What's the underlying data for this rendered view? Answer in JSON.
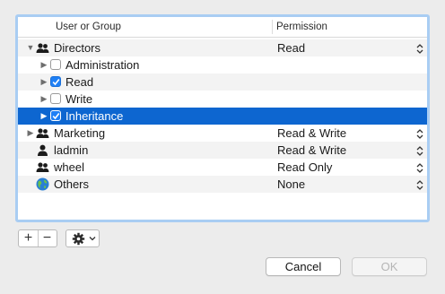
{
  "table": {
    "columns": {
      "user_or_group": "User or Group",
      "permission": "Permission"
    },
    "rows": [
      {
        "name": "Directors",
        "permission": "Read",
        "kind": "group",
        "expanded": true
      },
      {
        "name": "Administration",
        "checked": false,
        "kind": "privilege"
      },
      {
        "name": "Read",
        "checked": true,
        "kind": "privilege"
      },
      {
        "name": "Write",
        "checked": false,
        "kind": "privilege"
      },
      {
        "name": "Inheritance",
        "checked": true,
        "kind": "privilege",
        "selected": true
      },
      {
        "name": "Marketing",
        "permission": "Read & Write",
        "kind": "group",
        "expanded": false
      },
      {
        "name": "ladmin",
        "permission": "Read & Write",
        "kind": "user"
      },
      {
        "name": "wheel",
        "permission": "Read Only",
        "kind": "group"
      },
      {
        "name": "Others",
        "permission": "None",
        "kind": "globe"
      }
    ]
  },
  "controls": {
    "add_label": "+",
    "remove_label": "−",
    "action_menu_icon": "gear-icon",
    "cancel_label": "Cancel",
    "ok_label": "OK"
  },
  "colors": {
    "selection": "#0d66d0",
    "focus_ring": "#a9cdf3",
    "checkbox_checked": "#1f80f6"
  }
}
